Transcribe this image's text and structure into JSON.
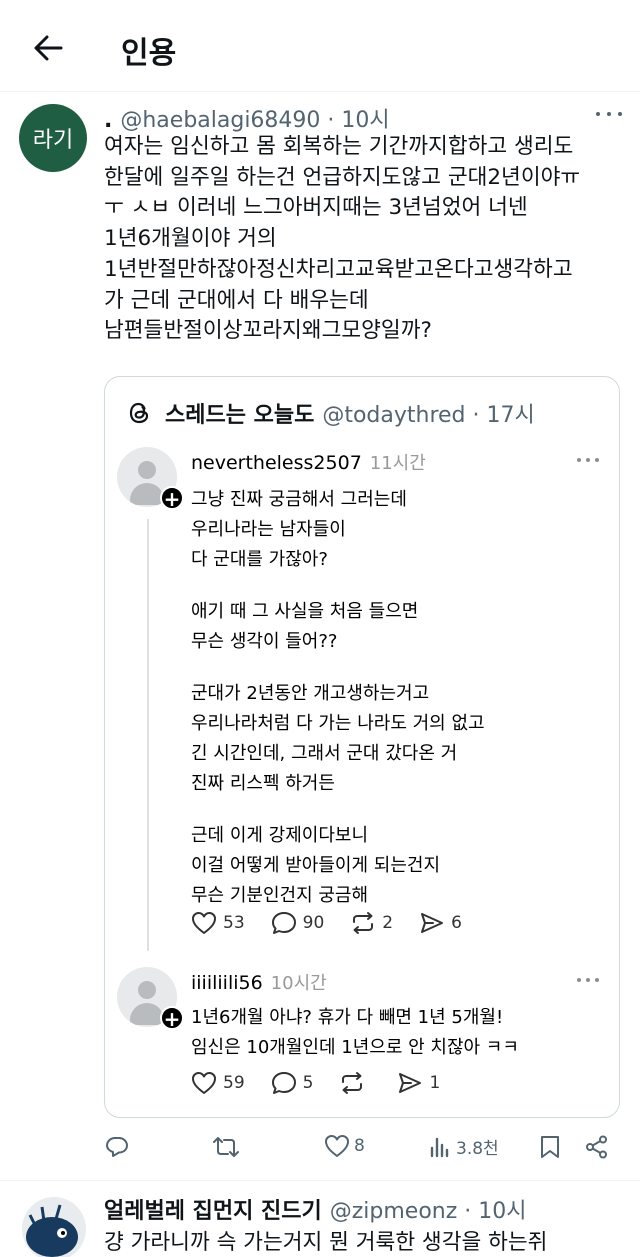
{
  "header": {
    "title": "인용"
  },
  "post": {
    "avatar_text": "라기",
    "display_name": ".",
    "handle_time": "@haebalagi68490 · 10시",
    "text": "여자는 임신하고 몸 회복하는 기간까지합하고 생리도\n한달에 일주일 하는건 언급하지도않고 군대2년이야ㅠ\nㅜ ㅅㅂ 이러네 느그아버지때는 3년넘었어 너넨\n1년6개월이야 거의\n1년반절만하잖아정신차리고교육받고온다고생각하고\n가 근데 군대에서 다 배우는데\n남편들반절이상꼬라지왜그모양일까?"
  },
  "quote": {
    "name": "스레드는 오늘도",
    "handle_time": "@todaythred · 17시",
    "threads": [
      {
        "username": "nevertheless2507",
        "time": "11시간",
        "paragraphs": [
          "그냥 진짜 궁금해서 그러는데\n우리나라는 남자들이\n다 군대를 가잖아?",
          "애기 때 그 사실을 처음 들으면\n무슨 생각이 들어??",
          "군대가 2년동안 개고생하는거고\n우리나라처럼 다 가는 나라도 거의 없고\n긴 시간인데, 그래서 군대 갔다온 거\n진짜 리스펙 하거든",
          "근데 이게 강제이다보니\n이걸 어떻게 받아들이게 되는건지\n무슨 기분인건지 궁금해"
        ],
        "likes": "53",
        "replies": "90",
        "reposts": "2",
        "shares": "6"
      },
      {
        "username": "iiiiliili56",
        "time": "10시간",
        "paragraphs": [
          "1년6개월 아냐? 휴가 다 빼면 1년 5개월!\n임신은 10개월인데 1년으로 안 치잖아 ㅋㅋ"
        ],
        "likes": "59",
        "replies": "5",
        "reposts": "",
        "shares": "1"
      }
    ]
  },
  "actions": {
    "likes": "8",
    "views": "3.8천"
  },
  "next_post": {
    "display_name": "얼레벌레 집먼지 진드기",
    "handle_time": "@zipmeonz · 10시",
    "text": "걍 가라니까 슥 가는거지 뭔 거룩한 생각을 하는쥐"
  },
  "colors": {
    "avatar_bg": "#1f5e43",
    "muted": "#536471",
    "border": "#cfd9de"
  }
}
